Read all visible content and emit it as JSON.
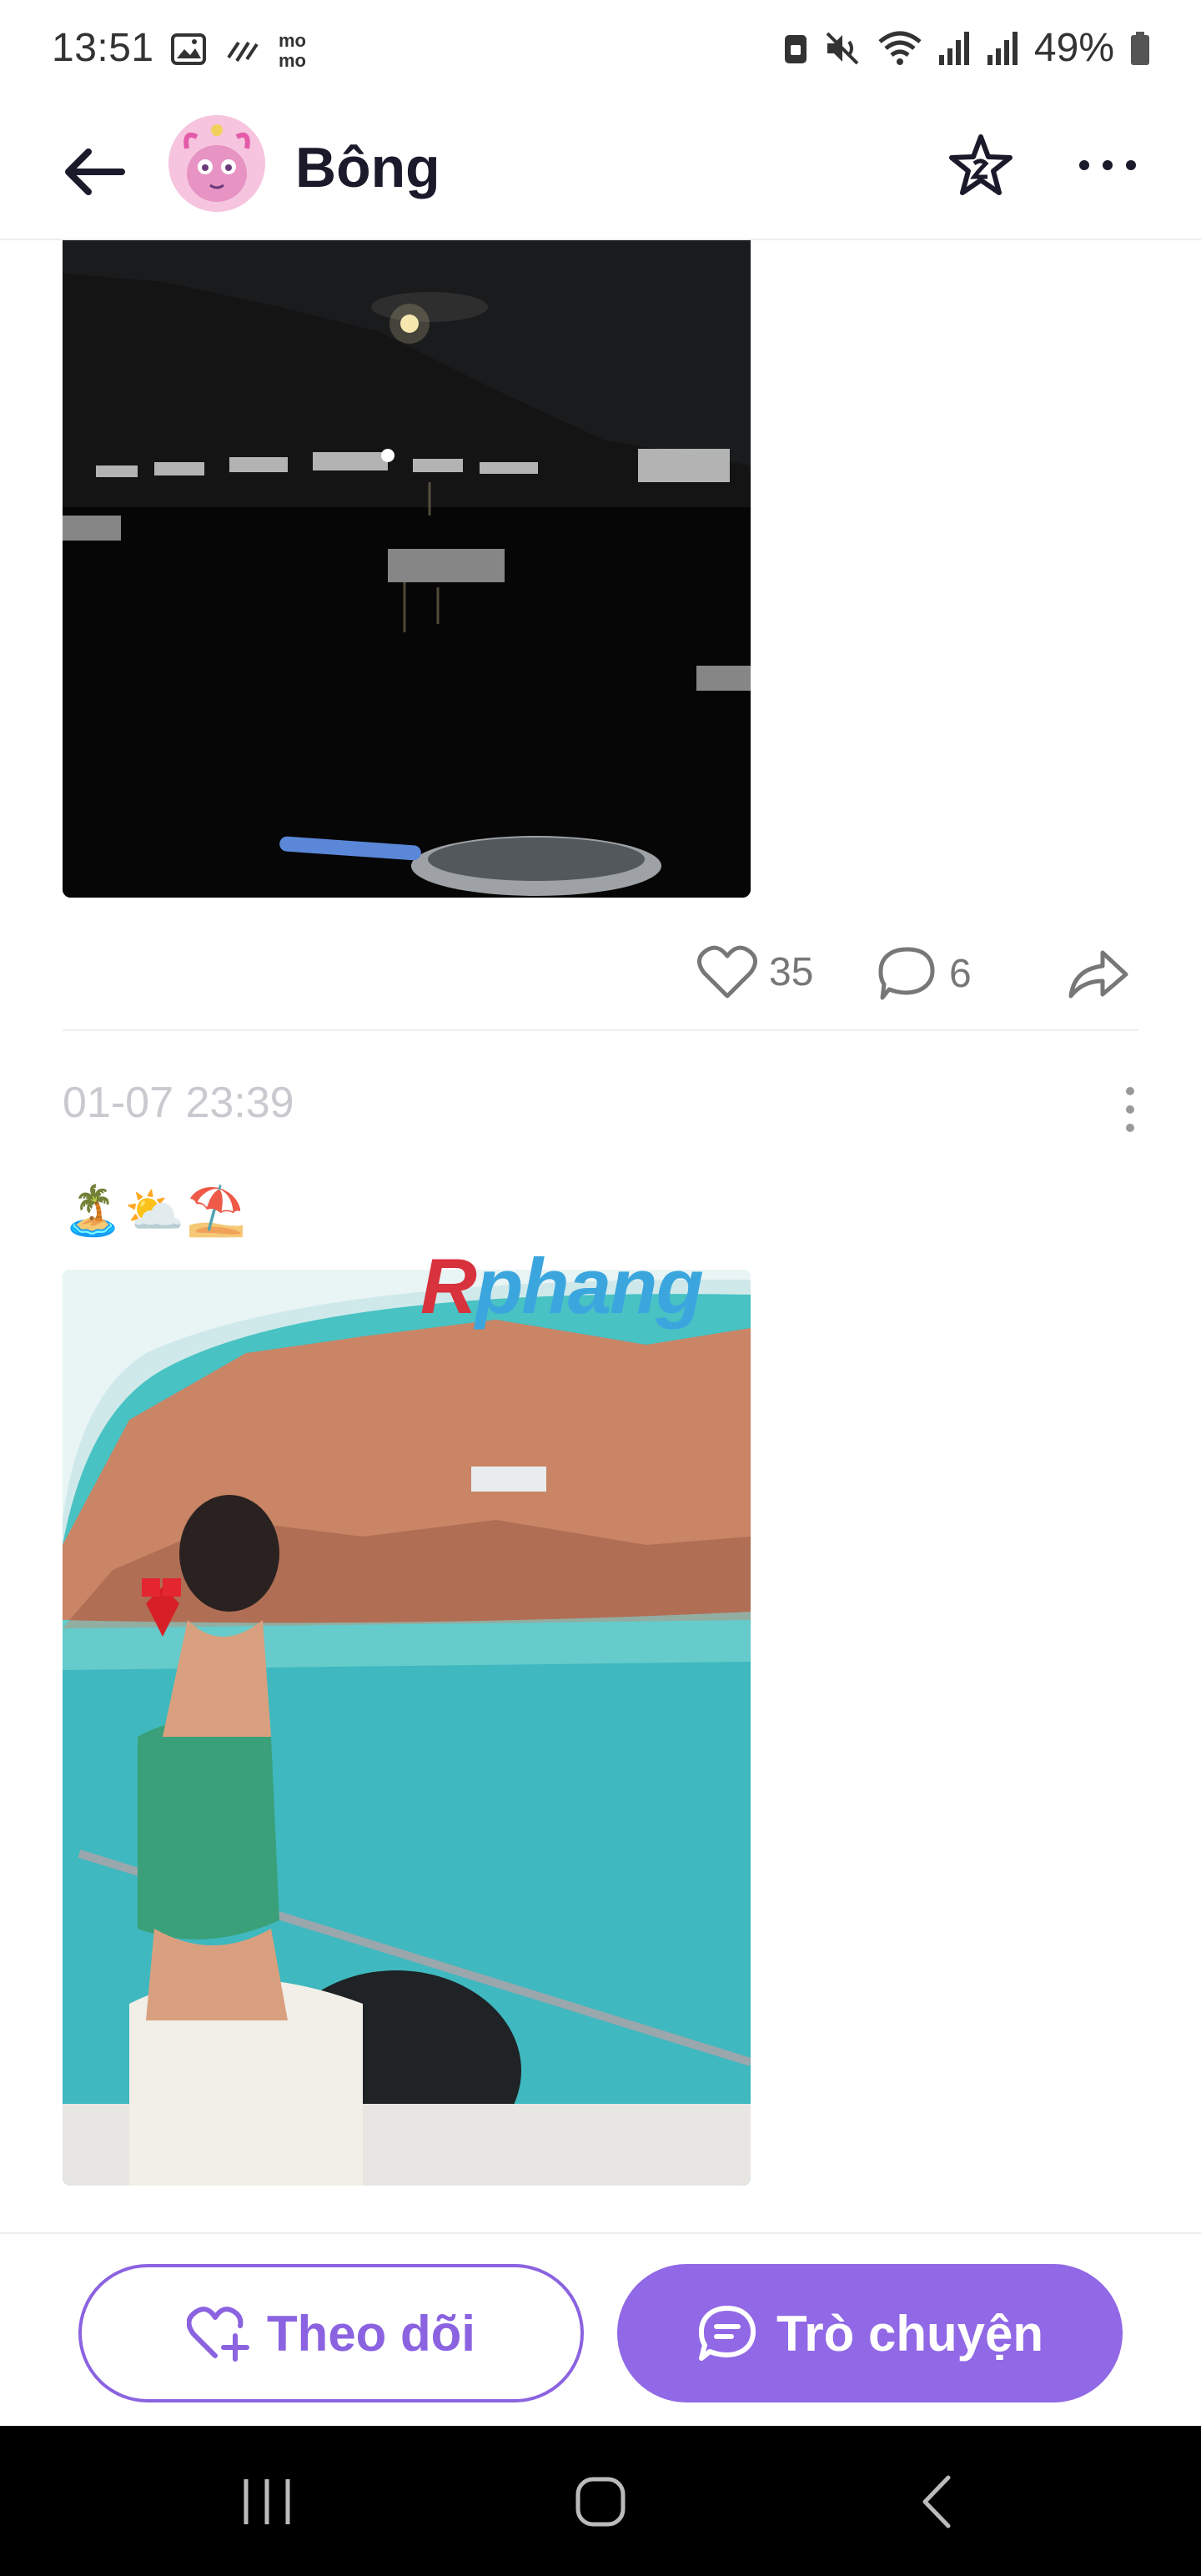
{
  "status_bar": {
    "time": "13:51",
    "battery": "49%",
    "left_icons": [
      "gallery-icon",
      "sync-icon",
      "momo-icon"
    ],
    "right_icons": [
      "lock-icon",
      "mute-icon",
      "wifi-icon",
      "signal-icon",
      "signal-icon",
      "battery-icon"
    ]
  },
  "header": {
    "back_icon": "arrow-left-icon",
    "profile_name": "Bông",
    "favorite_icon": "star-icon",
    "menu_icon": "more-horizontal-icon"
  },
  "posts": [
    {
      "image": "night-harbor-photo",
      "likes": "35",
      "comments": "6"
    },
    {
      "date": "01-07 23:39",
      "emoji": "🏝️⛅⛱️",
      "image": "sea-boat-photo",
      "watermark": {
        "part1": "R",
        "part2": "phang"
      }
    }
  ],
  "bottom_bar": {
    "follow_label": "Theo dõi",
    "chat_label": "Trò chuyện"
  },
  "colors": {
    "accent": "#8b63e0",
    "accent_fill": "#9168e6",
    "muted_text": "#c9c9cf"
  }
}
